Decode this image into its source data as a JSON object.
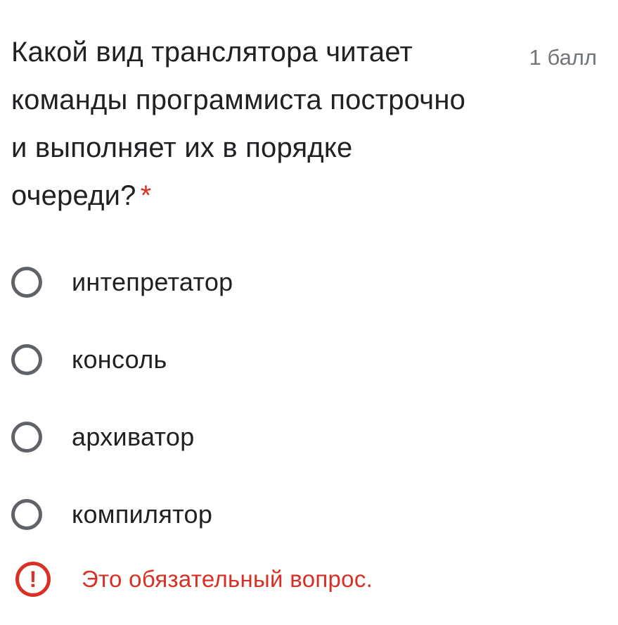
{
  "question": {
    "title": "Какой вид транслятора читает команды программиста построчно и выполняет их в порядке очереди?",
    "required_marker": "*",
    "points": "1 балл"
  },
  "options": [
    {
      "label": "интепретатор",
      "selected": false
    },
    {
      "label": "консоль",
      "selected": false
    },
    {
      "label": "архиватор",
      "selected": false
    },
    {
      "label": "компилятор",
      "selected": false
    }
  ],
  "error": {
    "icon": "exclamation-circle-icon",
    "icon_glyph": "!",
    "message": "Это обязательный вопрос."
  },
  "colors": {
    "text": "#202124",
    "muted": "#70757a",
    "radio": "#5f6368",
    "error": "#d93025"
  }
}
